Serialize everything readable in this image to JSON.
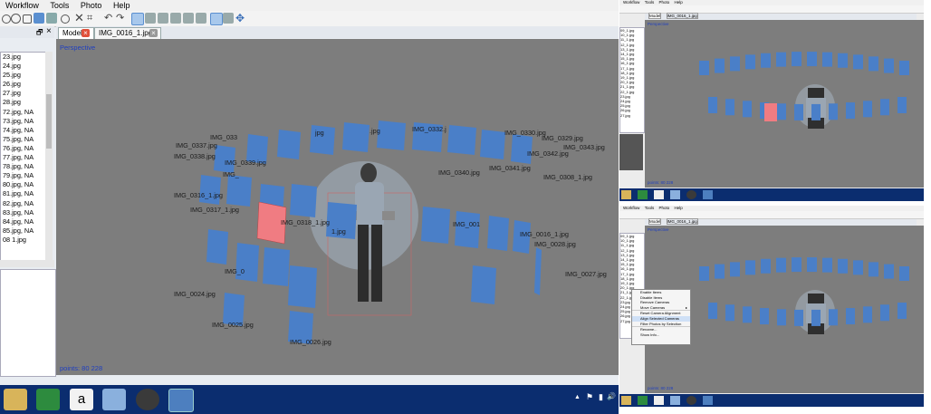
{
  "main_window": {
    "menu": [
      "Workflow",
      "Tools",
      "Photo",
      "Help"
    ],
    "tabs": [
      {
        "label": "Model",
        "close": "×"
      },
      {
        "label": "IMG_0016_1.jpg",
        "close": "×"
      }
    ],
    "panel_controls": {
      "float": "🗗",
      "close": "×"
    },
    "file_list": [
      "23.jpg",
      "24.jpg",
      "25.jpg",
      "26.jpg",
      "27.jpg",
      "28.jpg",
      "72.jpg, NA",
      "73.jpg, NA",
      "74.jpg, NA",
      "75.jpg, NA",
      "76.jpg, NA",
      "77.jpg, NA",
      "78.jpg, NA",
      "79.jpg, NA",
      "80.jpg, NA",
      "81.jpg, NA",
      "82.jpg, NA",
      "83.jpg, NA",
      "84.jpg, NA",
      "85.jpg, NA",
      "08 1.jpg"
    ],
    "viewport_mode": "Perspective",
    "status": "points: 80 228",
    "camera_labels": [
      "IMG_033",
      "IMG_0337.jpg",
      "IMG_0338.jpg",
      "IMG_0339.jpg",
      "IMG_",
      "IMG_0316_1.jpg",
      "IMG_0317_1.jpg",
      "IMG_0318_1.jpg",
      "IMG_001",
      "IMG_0016_1.jpg",
      "IMG_0028.jpg",
      "IMG_0027.jpg",
      "IMG_0340.jpg",
      "IMG_0341.jpg",
      "IMG_0342.jpg",
      "IMG_0343.jpg",
      "IMG_0329.jpg",
      "IMG_0330.jpg",
      "IMG_0308_1.jpg",
      "IMG_0332.j",
      "IMG_0024.jpg",
      "IMG_0025.jpg",
      "IMG_0026.jpg",
      "IMG_0",
      "jpg",
      ".jpg",
      "1.jpg"
    ]
  },
  "taskbar": {
    "icons": [
      "folder-icon",
      "excel-icon",
      "amazon-icon",
      "paint-icon",
      "webcam-icon",
      "film-icon"
    ],
    "tray": [
      "▲",
      "⚑",
      "▮",
      "🔊"
    ]
  },
  "top_right": {
    "menu": [
      "Workflow",
      "Tools",
      "Photo",
      "Help"
    ],
    "tabs": [
      "Model",
      "IMG_0016_1.jpg"
    ],
    "viewport_mode": "Perspective",
    "status": "points: 80 228",
    "file_list": [
      "09_1.jpg",
      "10_1.jpg",
      "11_1.jpg",
      "12_1.jpg",
      "13_1.jpg",
      "14_1.jpg",
      "15_1.jpg",
      "16_1.jpg",
      "17_1.jpg",
      "18_1.jpg",
      "19_1.jpg",
      "20_1.jpg",
      "21_1.jpg",
      "22_1.jpg",
      "23.jpg",
      "24.jpg",
      "25.jpg",
      "26.jpg",
      "27.jpg"
    ]
  },
  "bottom_right": {
    "menu": [
      "Workflow",
      "Tools",
      "Photo",
      "Help"
    ],
    "tabs": [
      "Model",
      "IMG_0016_1.jpg"
    ],
    "viewport_mode": "Perspective",
    "status": "points: 80 228",
    "context_menu": [
      "Enable Items",
      "Disable Items",
      "Remove Cameras",
      "Move Cameras",
      "Reset Camera Alignment",
      "Align Selected Cameras",
      "Filter Photos by Selection",
      "Rename...",
      "Show Info..."
    ],
    "submenu_arrow": "▸",
    "file_list": [
      "09_1.jpg",
      "10_1.jpg",
      "11_1.jpg",
      "12_1.jpg",
      "13_1.jpg",
      "14_1.jpg",
      "15_1.jpg",
      "16_1.jpg",
      "17_1.jpg",
      "18_1.jpg",
      "19_1.jpg",
      "20_1.jpg",
      "21_1.jpg",
      "22_1.jpg",
      "23.jpg",
      "24.jpg",
      "25.jpg",
      "26.jpg",
      "27.jpg"
    ]
  },
  "colors": {
    "camera": "#4a7fc8",
    "selected_camera": "#f07c82",
    "viewport": "#7d7d7d",
    "taskbar": "#0b2d6f",
    "mode_text": "#1f3fbf"
  }
}
